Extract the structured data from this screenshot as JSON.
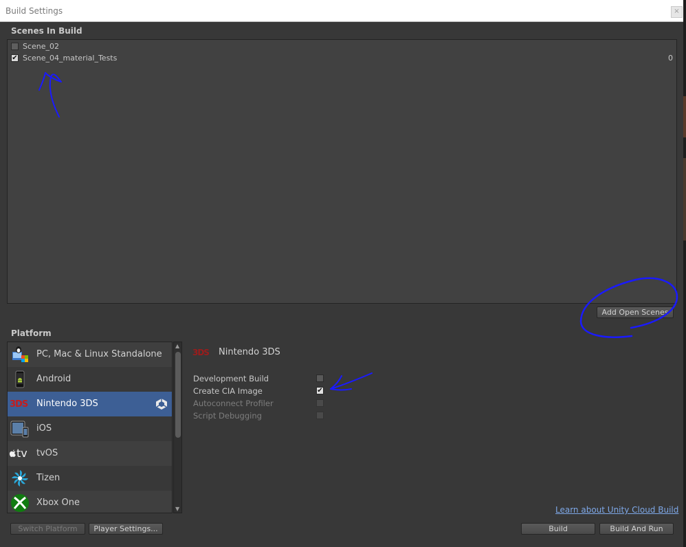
{
  "window": {
    "title": "Build Settings",
    "close_label": "×"
  },
  "scenes": {
    "header": "Scenes In Build",
    "items": [
      {
        "name": "Scene_02",
        "checked": false,
        "index": ""
      },
      {
        "name": "Scene_04_material_Tests",
        "checked": true,
        "index": "0"
      }
    ],
    "add_open_scenes_label": "Add Open Scenes"
  },
  "platform": {
    "header": "Platform",
    "items": [
      {
        "label": "PC, Mac & Linux Standalone",
        "icon": "pc-mac-linux-icon",
        "selected": false
      },
      {
        "label": "Android",
        "icon": "android-phone-icon",
        "selected": false
      },
      {
        "label": "Nintendo 3DS",
        "icon": "nintendo-3ds-icon",
        "selected": true
      },
      {
        "label": "iOS",
        "icon": "ios-devices-icon",
        "selected": false
      },
      {
        "label": "tvOS",
        "icon": "apple-tv-icon",
        "selected": false
      },
      {
        "label": "Tizen",
        "icon": "tizen-icon",
        "selected": false
      },
      {
        "label": "Xbox One",
        "icon": "xbox-icon",
        "selected": false
      }
    ],
    "logo_3ds_text": "3DS",
    "tvos_logo_text": "tv"
  },
  "settings": {
    "platform_name": "Nintendo 3DS",
    "options": [
      {
        "label": "Development Build",
        "checked": false,
        "enabled": true
      },
      {
        "label": "Create CIA Image",
        "checked": true,
        "enabled": true
      },
      {
        "label": "Autoconnect Profiler",
        "checked": false,
        "enabled": false
      },
      {
        "label": "Script Debugging",
        "checked": false,
        "enabled": false
      }
    ]
  },
  "footer": {
    "cloud_build_link": "Learn about Unity Cloud Build",
    "switch_platform_label": "Switch Platform",
    "player_settings_label": "Player Settings...",
    "build_label": "Build",
    "build_and_run_label": "Build And Run"
  },
  "colors": {
    "selected_row": "#3d5f95",
    "annotation_ink": "#1a1aff",
    "link": "#7ea8e8"
  },
  "check_glyph": "✔"
}
